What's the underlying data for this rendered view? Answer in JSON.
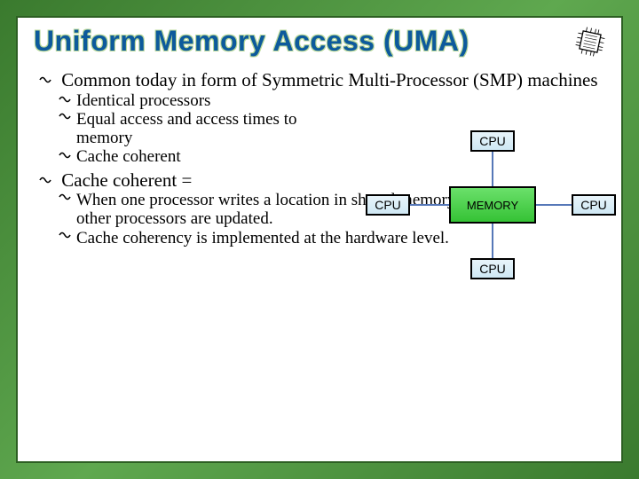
{
  "title": "Uniform Memory Access (UMA)",
  "bullets": {
    "b1": {
      "text": "Common today in form of Symmetric Multi-Processor (SMP) machines",
      "sub": [
        "Identical processors",
        "Equal access and access times to memory",
        "Cache coherent"
      ]
    },
    "b2": {
      "text": "Cache coherent =",
      "sub": [
        "When one processor writes a location in shared memory, all other processors are updated.",
        "Cache coherency is implemented at the hardware level."
      ]
    }
  },
  "diagram": {
    "cpu": "CPU",
    "memory": "MEMORY"
  }
}
